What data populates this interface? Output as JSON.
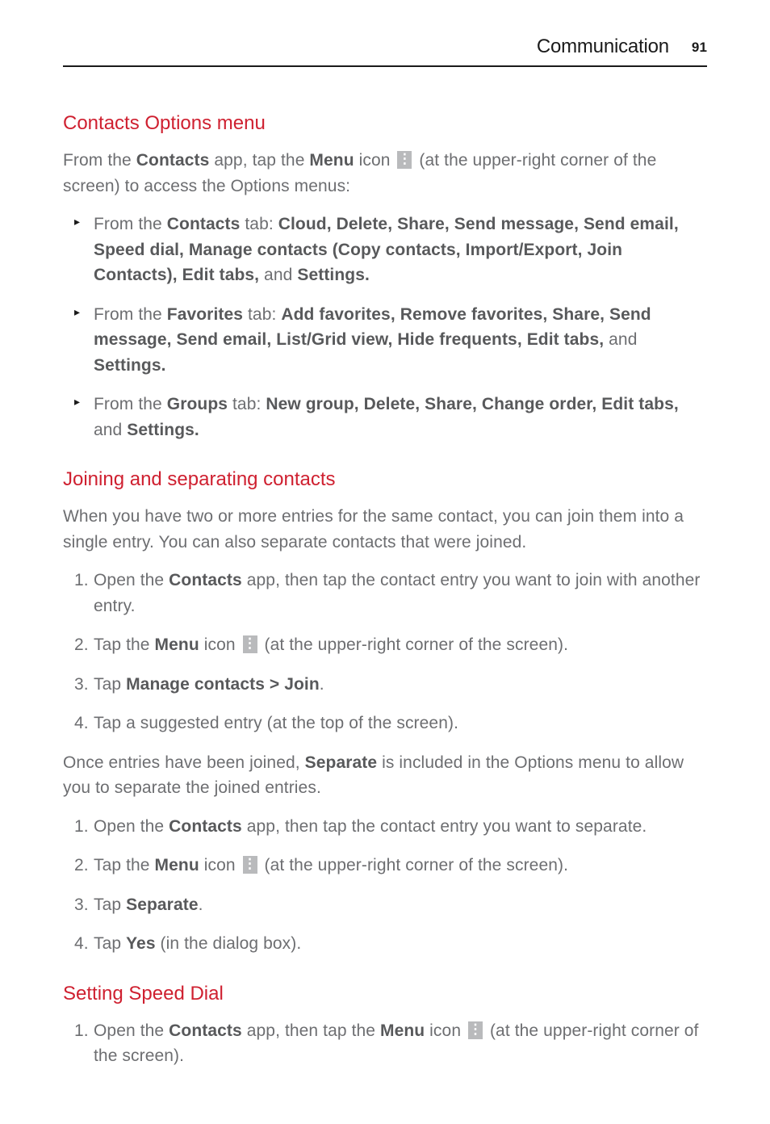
{
  "header": {
    "title": "Communication",
    "page_number": "91"
  },
  "sections": [
    {
      "heading": "Contacts Options menu",
      "intro_parts": [
        "From the ",
        "Contacts",
        " app, tap the ",
        "Menu",
        " icon ",
        " (at the upper-right corner of the screen) to access the Options menus:"
      ],
      "bullets": [
        {
          "pre": "From the ",
          "b1": "Contacts",
          "mid1": " tab: ",
          "rest": "Cloud, Delete, Share, Send message, Send email, Speed dial, Manage contacts (Copy contacts, Import/Export, Join Contacts), Edit tabs,",
          "tail_light": " and ",
          "tail_bold": "Settings."
        },
        {
          "pre": "From the ",
          "b1": "Favorites",
          "mid1": " tab: ",
          "rest": "Add favorites, Remove favorites, Share, Send message, Send email, List/Grid view, Hide frequents, Edit tabs,",
          "tail_light": " and ",
          "tail_bold": "Settings."
        },
        {
          "pre": "From the ",
          "b1": "Groups",
          "mid1": " tab: ",
          "rest": "New group, Delete, Share, Change order, Edit tabs,",
          "tail_light": " and ",
          "tail_bold": "Settings."
        }
      ]
    },
    {
      "heading": "Joining and separating contacts",
      "intro": "When you have two or more entries for the same contact, you can join them into a single entry. You can also separate contacts that were joined.",
      "steps1": [
        {
          "num": "1.",
          "pre": "Open the ",
          "b1": "Contacts",
          "post": " app, then tap the contact entry you want to join with another entry."
        },
        {
          "num": "2.",
          "pre": "Tap the ",
          "b1": "Menu",
          "mid": " icon ",
          "icon": true,
          "post": " (at the upper-right corner of the screen)."
        },
        {
          "num": "3.",
          "pre": "Tap ",
          "b1": "Manage contacts > Join",
          "post": "."
        },
        {
          "num": "4.",
          "pre": "Tap a suggested entry (at the top of the screen)."
        }
      ],
      "mid_para_parts": [
        "Once entries have been joined, ",
        "Separate",
        " is included in the Options menu to allow you to separate the joined entries."
      ],
      "steps2": [
        {
          "num": "1.",
          "pre": "Open the ",
          "b1": "Contacts",
          "post": " app, then tap the contact entry you want to separate."
        },
        {
          "num": "2.",
          "pre": "Tap the ",
          "b1": "Menu",
          "mid": " icon ",
          "icon": true,
          "post": " (at the upper-right corner of the screen)."
        },
        {
          "num": "3.",
          "pre": "Tap ",
          "b1": "Separate",
          "post": "."
        },
        {
          "num": "4.",
          "pre": "Tap ",
          "b1": "Yes",
          "post": " (in the dialog box)."
        }
      ]
    },
    {
      "heading": "Setting Speed Dial",
      "steps": [
        {
          "num": "1.",
          "pre": "Open the ",
          "b1": "Contacts",
          "mid": " app, then tap the ",
          "b2": "Menu",
          "mid2": " icon ",
          "icon": true,
          "post": " (at the upper-right corner of the screen)."
        }
      ]
    }
  ]
}
